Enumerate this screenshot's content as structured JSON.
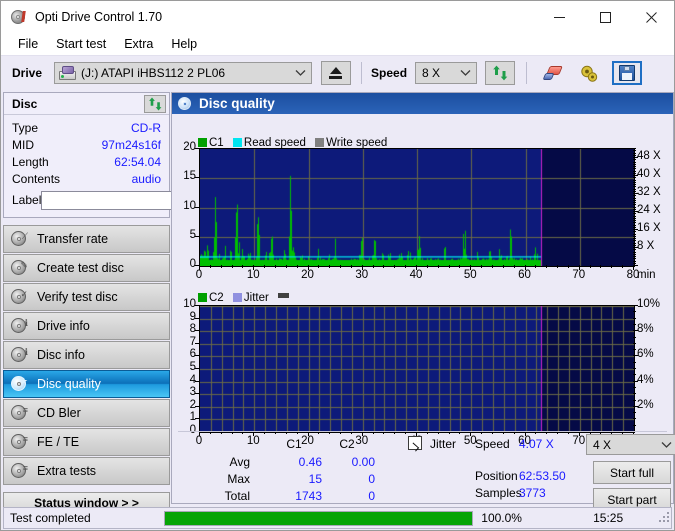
{
  "window": {
    "title": "Opti Drive Control 1.70",
    "icon": "disc-icon",
    "minimize_label": "minimize-icon",
    "maximize_label": "maximize-icon",
    "close_label": "close-icon"
  },
  "menu": {
    "items": [
      {
        "label": "File"
      },
      {
        "label": "Start test"
      },
      {
        "label": "Extra"
      },
      {
        "label": "Help"
      }
    ]
  },
  "toolbar": {
    "drive_label": "Drive",
    "drive_value": "(J:)  ATAPI iHBS112  2 PL06",
    "eject_label": "eject-icon",
    "speed_label": "Speed",
    "speed_value": "8 X",
    "refresh_label": "refresh-icon",
    "erase_label": "erase-icon",
    "settings_label": "settings-icon",
    "save_label": "save-icon"
  },
  "disc_panel": {
    "title": "Disc",
    "refresh_label": "refresh-icon",
    "rows": [
      {
        "key": "Type",
        "value": "CD-R"
      },
      {
        "key": "MID",
        "value": "97m24s16f"
      },
      {
        "key": "Length",
        "value": "62:54.04"
      },
      {
        "key": "Contents",
        "value": "audio"
      }
    ],
    "label_key": "Label",
    "label_value": "",
    "label_placeholder": "",
    "disc_button_label": "cd-icon"
  },
  "sidebar": {
    "items": [
      {
        "label": "Transfer rate",
        "selected": false
      },
      {
        "label": "Create test disc",
        "selected": false
      },
      {
        "label": "Verify test disc",
        "selected": false
      },
      {
        "label": "Drive info",
        "selected": false
      },
      {
        "label": "Disc info",
        "selected": false
      },
      {
        "label": "Disc quality",
        "selected": true
      },
      {
        "label": "CD Bler",
        "selected": false
      },
      {
        "label": "FE / TE",
        "selected": false
      },
      {
        "label": "Extra tests",
        "selected": false
      }
    ],
    "status_window_label": "Status window > >"
  },
  "main": {
    "title": "Disc quality",
    "icon": "disc-quality-icon"
  },
  "stats": {
    "col_headers": [
      "C1",
      "C2"
    ],
    "rows": [
      {
        "label": "Avg",
        "c1": "0.46",
        "c2": "0.00"
      },
      {
        "label": "Max",
        "c1": "15",
        "c2": "0"
      },
      {
        "label": "Total",
        "c1": "1743",
        "c2": "0"
      }
    ],
    "jitter_label": "Jitter",
    "jitter_checked": true,
    "speed_label": "Speed",
    "speed_value": "4.07 X",
    "position_label": "Position",
    "position_value": "62:53.50",
    "samples_label": "Samples",
    "samples_value": "3773",
    "speed_select_value": "4 X",
    "start_full_label": "Start full",
    "start_part_label": "Start part"
  },
  "statusbar": {
    "message": "Test completed",
    "progress_percent": "100.0%",
    "progress_value": 100,
    "elapsed": "15:25"
  },
  "colors": {
    "c1": "#00c000",
    "c2": "#00c000",
    "read_speed": "#00e5f0",
    "write_speed": "#808080",
    "jitter": "#9090e0",
    "plot_bg": "#050a46",
    "grid": "#6b6b45",
    "marker": "#cc22cc",
    "accent_blue": "#1a1aff",
    "progress_green": "#06a406",
    "selected_nav": "#0b6fb8"
  },
  "chart_data": [
    {
      "type": "bar",
      "id": "c1-chart",
      "title": "",
      "xlabel": "min",
      "ylabel": "",
      "xlim": [
        0,
        80
      ],
      "ylim": [
        0,
        20
      ],
      "xticks": [
        0,
        10,
        20,
        30,
        40,
        50,
        60,
        70,
        80
      ],
      "yticks": [
        0,
        5,
        10,
        15,
        20
      ],
      "y2lim": [
        0,
        52
      ],
      "y2ticks": [
        "8 X",
        "16 X",
        "24 X",
        "32 X",
        "40 X",
        "48 X"
      ],
      "y2tickvals": [
        8,
        16,
        24,
        32,
        40,
        48
      ],
      "grid": true,
      "legend": [
        {
          "name": "C1",
          "color": "#00c000"
        },
        {
          "name": "Read speed",
          "color": "#00e5f0"
        },
        {
          "name": "Write speed",
          "color": "#808080"
        }
      ],
      "data_end_x": 62.9,
      "marker_x": 62.9,
      "read_speed_series": {
        "name": "Read speed",
        "color": "#00e5f0",
        "points": [
          [
            0.0,
            4.0
          ],
          [
            4.0,
            4.05
          ],
          [
            10.0,
            4.05
          ],
          [
            20.0,
            4.07
          ],
          [
            30.0,
            4.07
          ],
          [
            40.0,
            4.07
          ],
          [
            50.0,
            4.07
          ],
          [
            62.9,
            4.07
          ]
        ]
      },
      "c1_series": {
        "name": "C1",
        "color": "#00c000",
        "sampled_values": [
          2.1,
          1.4,
          3.2,
          5.0,
          1.2,
          0.8,
          2.6,
          15.0,
          2.0,
          1.1,
          0.9,
          2.2,
          1.5,
          0.7,
          3.0,
          1.0,
          0.6,
          11.6,
          2.4,
          1.0,
          3.6,
          1.2,
          0.8,
          4.4,
          1.0,
          0.6,
          0.9,
          9.8,
          1.4,
          0.7,
          2.0,
          1.1,
          0.5,
          8.0,
          1.6,
          0.9,
          1.2,
          0.6,
          0.4,
          2.8,
          1.0,
          0.7,
          12.8,
          3.6,
          1.8,
          1.0,
          0.7,
          2.2,
          0.9,
          0.5,
          1.6,
          0.8,
          0.4,
          1.0,
          0.6,
          3.0,
          1.2,
          0.8,
          0.5,
          1.4,
          2.0,
          0.9,
          0.6,
          4.6,
          1.2,
          0.7,
          1.0,
          0.5,
          2.4,
          0.8,
          0.6,
          1.8,
          0.9,
          0.4,
          1.0,
          6.4,
          2.0,
          1.0,
          0.6,
          1.4,
          0.8,
          5.6,
          1.6,
          0.9,
          0.5,
          2.0,
          1.0,
          0.6,
          3.0,
          1.2,
          0.7,
          1.0,
          0.4,
          4.0,
          1.4,
          0.8,
          0.5,
          2.6,
          1.0,
          0.6,
          1.8,
          0.9,
          5.0,
          1.4,
          0.8,
          0.5,
          1.2,
          0.7,
          2.2,
          1.0,
          0.6,
          1.6,
          0.9,
          0.4,
          3.4,
          1.2,
          0.7,
          1.0,
          2.0,
          0.8,
          0.5,
          1.4,
          0.9,
          6.0,
          1.8,
          1.0,
          0.6,
          1.2,
          0.7,
          2.8,
          1.0,
          0.5,
          1.6,
          0.8,
          0.4,
          4.2,
          1.4,
          0.9,
          0.6,
          1.0,
          2.2,
          0.8,
          0.5,
          1.8,
          1.0,
          5.4,
          1.4,
          0.7,
          0.4,
          1.2,
          0.9,
          2.4,
          1.0,
          0.6,
          1.6,
          0.8,
          3.8,
          1.2,
          0.7,
          1.0
        ],
        "avg": 0.46,
        "max": 15,
        "total": 1743
      }
    },
    {
      "type": "bar",
      "id": "c2-chart",
      "title": "",
      "xlabel": "min",
      "ylabel": "",
      "xlim": [
        0,
        80
      ],
      "ylim": [
        0,
        10
      ],
      "xticks": [
        0,
        10,
        20,
        30,
        40,
        50,
        60,
        70,
        80
      ],
      "yticks": [
        0,
        1,
        2,
        3,
        4,
        5,
        6,
        7,
        8,
        9,
        10
      ],
      "y2lim": [
        0,
        10
      ],
      "y2ticks": [
        "2%",
        "4%",
        "6%",
        "8%",
        "10%"
      ],
      "y2tickvals": [
        2,
        4,
        6,
        8,
        10
      ],
      "grid": true,
      "legend": [
        {
          "name": "C2",
          "color": "#00c000"
        },
        {
          "name": "Jitter",
          "color": "#9090e0"
        }
      ],
      "data_end_x": 62.9,
      "marker_x": 62.9,
      "c2_series": {
        "name": "C2",
        "color": "#00c000",
        "sampled_values": [],
        "avg": 0.0,
        "max": 0,
        "total": 0
      },
      "jitter_series": {
        "name": "Jitter",
        "color": "#9090e0",
        "sampled_values": []
      }
    }
  ]
}
